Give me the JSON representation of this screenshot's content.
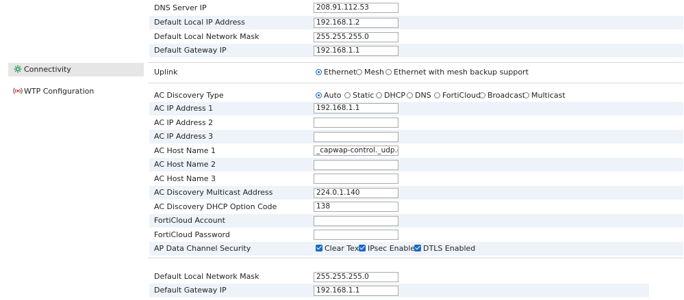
{
  "top_section": {
    "rows": [
      {
        "label": "DNS Server IP",
        "value": "208.91.112.53"
      },
      {
        "label": "Default Local IP Address",
        "value": "192.168.1.2"
      },
      {
        "label": "Default Local Network Mask",
        "value": "255.255.255.0"
      },
      {
        "label": "Default Gateway IP",
        "value": "192.168.1.1"
      }
    ]
  },
  "sidebar": {
    "items": [
      {
        "label": "Connectivity",
        "icon": "connectivity-icon",
        "active": true
      },
      {
        "label": "WTP Configuration",
        "icon": "wtp-broadcast-icon",
        "active": false
      }
    ]
  },
  "connectivity": {
    "uplink_label": "Uplink",
    "options": [
      "Ethernet",
      "Mesh",
      "Ethernet with mesh backup support"
    ],
    "selected": "Ethernet"
  },
  "wtp": {
    "discovery_label": "AC Discovery Type",
    "discovery_options": [
      "Auto",
      "Static",
      "DHCP",
      "DNS",
      "FortiCloud",
      "Broadcast",
      "Multicast"
    ],
    "discovery_selected": "Auto",
    "fields": [
      {
        "label": "AC IP Address 1",
        "value": "192.168.1.1"
      },
      {
        "label": "AC IP Address 2",
        "value": ""
      },
      {
        "label": "AC IP Address 3",
        "value": ""
      },
      {
        "label": "AC Host Name 1",
        "value": "_capwap-control._udp.exam"
      },
      {
        "label": "AC Host Name 2",
        "value": ""
      },
      {
        "label": "AC Host Name 3",
        "value": ""
      },
      {
        "label": "AC Discovery Multicast Address",
        "value": "224.0.1.140"
      },
      {
        "label": "AC Discovery DHCP Option Code",
        "value": "138"
      },
      {
        "label": "FortiCloud Account",
        "value": ""
      },
      {
        "label": "FortiCloud Password",
        "value": ""
      }
    ],
    "security_label": "AP Data Channel Security",
    "security_options": [
      {
        "label": "Clear Text",
        "checked": true
      },
      {
        "label": "IPsec Enabled",
        "checked": true
      },
      {
        "label": "DTLS Enabled",
        "checked": true
      }
    ]
  },
  "bottom_section": {
    "rows": [
      {
        "label": "Default Local Network Mask",
        "value": "255.255.255.0"
      },
      {
        "label": "Default Gateway IP",
        "value": "192.168.1.1"
      }
    ]
  },
  "colors": {
    "accent": "#1a6ac7",
    "row_alt": "#eef3f9",
    "sidebar_active": "#e6e6e6"
  }
}
